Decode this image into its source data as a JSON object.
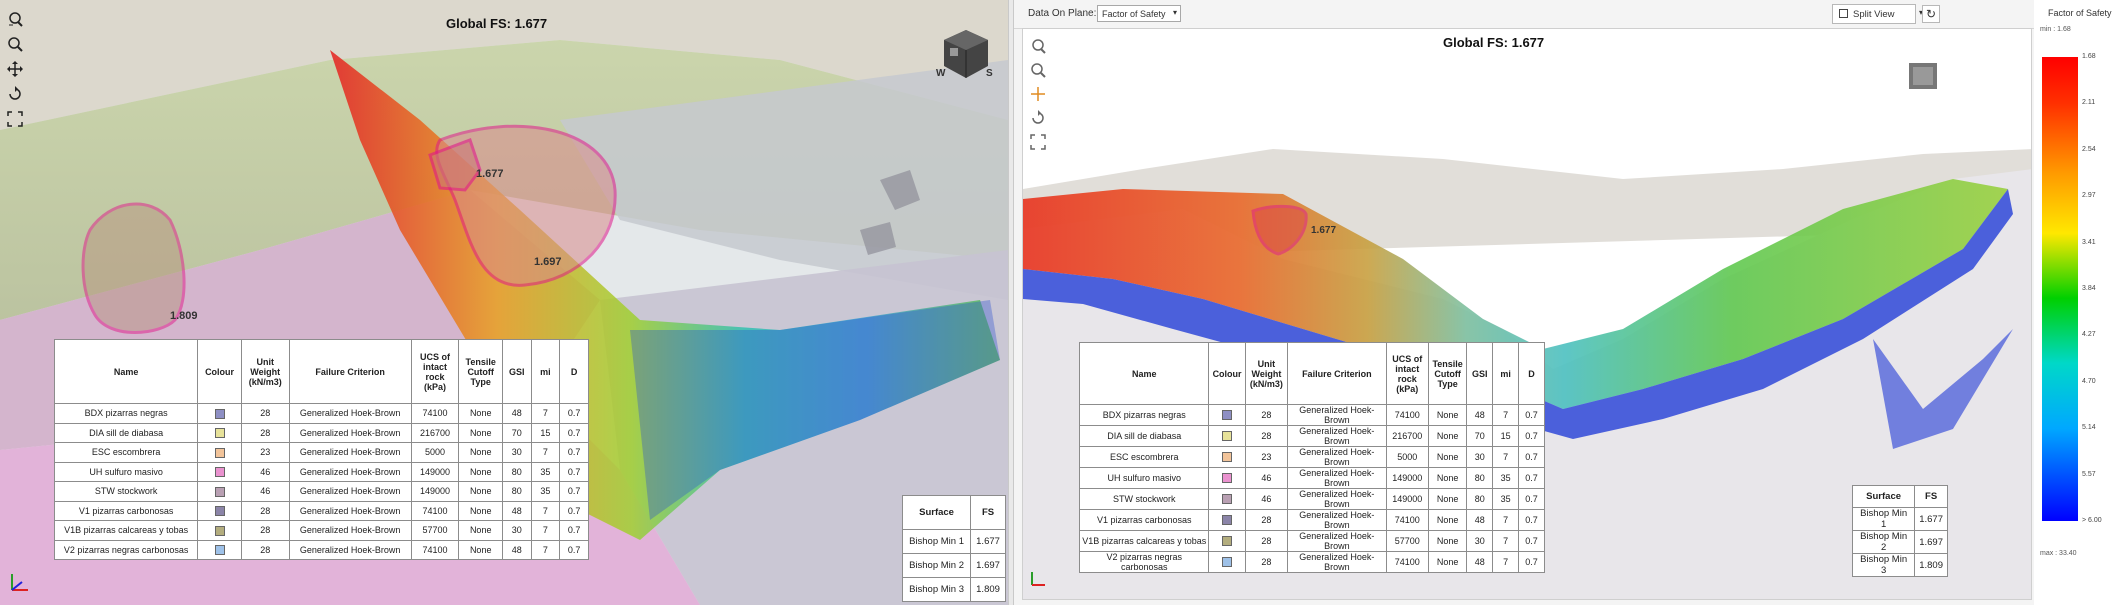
{
  "global_fs": "Global FS: 1.677",
  "left": {
    "labels": [
      "1.677",
      "1.697",
      "1.809"
    ],
    "cube_labels": [
      "W",
      "S"
    ]
  },
  "right": {
    "toolbar": {
      "data_label": "Data On Plane:",
      "data_value": "Factor of Safety",
      "split_view_label": "Split View"
    },
    "labels": [
      "1.677"
    ],
    "legend": {
      "title": "Factor of Safety",
      "min_label": "min : 1.68",
      "max_label": "max : 33.40",
      "ticks": [
        "1.68",
        "2.11",
        "2.54",
        "2.97",
        "3.41",
        "3.84",
        "4.27",
        "4.70",
        "5.14",
        "5.57",
        "> 6.00"
      ]
    }
  },
  "material_table": {
    "headers": [
      "Name",
      "Colour",
      "Unit Weight (kN/m3)",
      "Failure Criterion",
      "UCS of intact rock (kPa)",
      "Tensile Cutoff Type",
      "GSI",
      "mi",
      "D"
    ],
    "rows": [
      {
        "name": "BDX pizarras negras",
        "colour": "#8e8fc4",
        "weight": "28",
        "criterion": "Generalized Hoek-Brown",
        "ucs": "74100",
        "tensile": "None",
        "gsi": "48",
        "mi": "7",
        "d": "0.7"
      },
      {
        "name": "DIA sill de diabasa",
        "colour": "#e7e29a",
        "weight": "28",
        "criterion": "Generalized Hoek-Brown",
        "ucs": "216700",
        "tensile": "None",
        "gsi": "70",
        "mi": "15",
        "d": "0.7"
      },
      {
        "name": "ESC escombrera",
        "colour": "#f2c49a",
        "weight": "23",
        "criterion": "Generalized Hoek-Brown",
        "ucs": "5000",
        "tensile": "None",
        "gsi": "30",
        "mi": "7",
        "d": "0.7"
      },
      {
        "name": "UH sulfuro masivo",
        "colour": "#ea92cf",
        "weight": "46",
        "criterion": "Generalized Hoek-Brown",
        "ucs": "149000",
        "tensile": "None",
        "gsi": "80",
        "mi": "35",
        "d": "0.7"
      },
      {
        "name": "STW stockwork",
        "colour": "#b9a0b3",
        "weight": "46",
        "criterion": "Generalized Hoek-Brown",
        "ucs": "149000",
        "tensile": "None",
        "gsi": "80",
        "mi": "35",
        "d": "0.7"
      },
      {
        "name": "V1 pizarras carbonosas",
        "colour": "#8b84a8",
        "weight": "28",
        "criterion": "Generalized Hoek-Brown",
        "ucs": "74100",
        "tensile": "None",
        "gsi": "48",
        "mi": "7",
        "d": "0.7"
      },
      {
        "name": "V1B pizarras calcareas y tobas",
        "colour": "#b3ad7e",
        "weight": "28",
        "criterion": "Generalized Hoek-Brown",
        "ucs": "57700",
        "tensile": "None",
        "gsi": "30",
        "mi": "7",
        "d": "0.7"
      },
      {
        "name": "V2 pizarras negras carbonosas",
        "colour": "#9ec1e8",
        "weight": "28",
        "criterion": "Generalized Hoek-Brown",
        "ucs": "74100",
        "tensile": "None",
        "gsi": "48",
        "mi": "7",
        "d": "0.7"
      }
    ]
  },
  "fs_table": {
    "headers": [
      "Surface",
      "FS"
    ],
    "rows": [
      {
        "surface": "Bishop Min 1",
        "fs": "1.677"
      },
      {
        "surface": "Bishop Min 2",
        "fs": "1.697"
      },
      {
        "surface": "Bishop Min 3",
        "fs": "1.809"
      }
    ]
  },
  "icons": [
    "zoom-extents-icon",
    "zoom-icon",
    "pan-icon",
    "rotate-icon",
    "fit-icon",
    "view-cube-icon",
    "axes-triad-icon",
    "refresh-icon",
    "split-view-icon",
    "dropdown-arrow-icon"
  ],
  "colors": {
    "fs_low": "#ff0000",
    "fs_mid": "#00d000",
    "fs_high": "#0000ff",
    "slip_outline": "#e0198a"
  }
}
